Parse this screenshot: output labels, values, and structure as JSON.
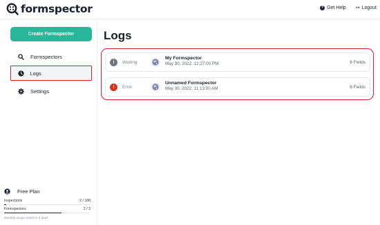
{
  "app": {
    "logo_text": "formspector"
  },
  "topbar": {
    "help_label": "Get Help",
    "logout_label": "Logout"
  },
  "sidebar": {
    "create_label": "Create Formspector",
    "items": [
      {
        "label": "Formspectors",
        "icon": "search-icon"
      },
      {
        "label": "Logs",
        "icon": "clock-icon",
        "active": true
      },
      {
        "label": "Settings",
        "icon": "gear-icon"
      }
    ]
  },
  "plan": {
    "name": "Free Plan",
    "inspections_label": "Inspections",
    "inspections_value": "2 / 100",
    "inspections_fraction": 0.02,
    "formspectors_label": "Formspectors",
    "formspectors_value": "2 / 3",
    "formspectors_fraction": 0.6667,
    "reset_note": "Monthly usage resets in 2 days"
  },
  "main": {
    "title": "Logs",
    "logs": [
      {
        "status": "Waiting",
        "status_icon": "info-icon",
        "status_color": "#6d7380",
        "name": "My Formspector",
        "date": "May 30, 2022, 12:27:00 PM",
        "fields": "6 Fields"
      },
      {
        "status": "Error",
        "status_icon": "error-icon",
        "status_color": "#d6331f",
        "name": "Unnamed Formspector",
        "date": "May 30, 2022, 11:13:00 AM",
        "fields": "6 Fields"
      }
    ]
  },
  "colors": {
    "accent": "#29b79a",
    "highlight": "#d62134"
  }
}
